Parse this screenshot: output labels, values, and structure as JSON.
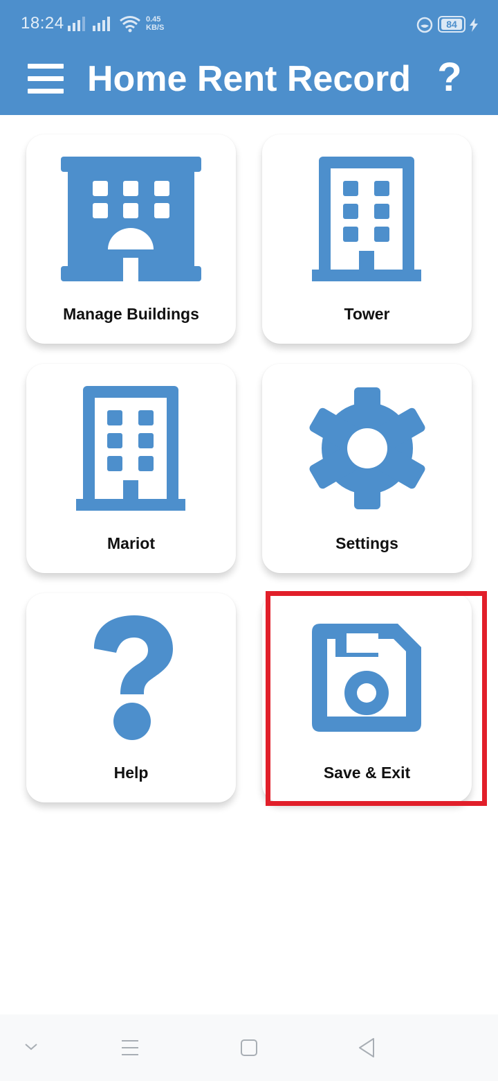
{
  "status_bar": {
    "time": "18:24",
    "speed_value": "0.45",
    "speed_unit": "KB/S",
    "battery": "84",
    "icons": [
      "signal-icon",
      "signal-icon",
      "wifi-icon",
      "alarm-icon",
      "battery-icon",
      "charging-icon"
    ]
  },
  "app_bar": {
    "title": "Home Rent Record",
    "help_glyph": "?",
    "menu_icon": "hamburger-menu-icon"
  },
  "tiles": [
    {
      "label": "Manage Buildings",
      "icon": "hotel-icon"
    },
    {
      "label": "Tower",
      "icon": "building-icon"
    },
    {
      "label": "Mariot",
      "icon": "building-icon"
    },
    {
      "label": "Settings",
      "icon": "gear-icon"
    },
    {
      "label": "Help",
      "icon": "question-mark-icon"
    },
    {
      "label": "Save & Exit",
      "icon": "floppy-disk-icon"
    }
  ],
  "nav_bar": [
    "chevron-down-icon",
    "menu-lines-icon",
    "home-square-icon",
    "back-triangle-icon"
  ],
  "colors": {
    "primary": "#4d8fcc",
    "highlight": "#e11f2a",
    "text": "#111111"
  }
}
